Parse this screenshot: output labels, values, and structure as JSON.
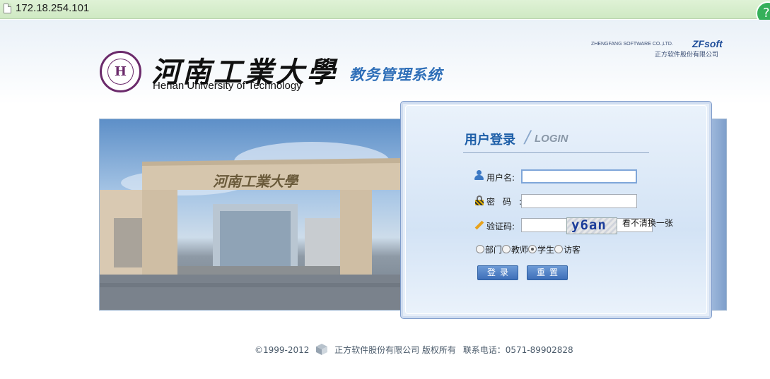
{
  "browser": {
    "url": "172.18.254.101"
  },
  "header": {
    "university_cn": "河南工業大學",
    "university_en": "Henan University of Technology",
    "system_name": "教务管理系统",
    "vendor_en": "ZHENGFANG SOFTWARE CO.,LTD.",
    "vendor_brand": "ZFsoft",
    "vendor_cn": "正方软件股份有限公司"
  },
  "login": {
    "title_cn": "用户登录",
    "title_slash": "/",
    "title_en": "LOGIN",
    "username_label": "用户名:",
    "username_value": "",
    "password_label": "密码:",
    "password_value": "",
    "captcha_label": "验证码:",
    "captcha_value": "",
    "captcha_image_text": "y6an",
    "captcha_refresh": "看不清换一张",
    "roles": [
      {
        "label": "部门",
        "checked": false
      },
      {
        "label": "教师",
        "checked": false
      },
      {
        "label": "学生",
        "checked": true
      },
      {
        "label": "访客",
        "checked": false
      }
    ],
    "login_button": "登录",
    "reset_button": "重置"
  },
  "campus_photo": {
    "gate_text": "河南工業大學"
  },
  "footer": {
    "copyright": "©1999-2012",
    "company": "正方软件股份有限公司 版权所有",
    "phone": "联系电话：0571-89902828"
  }
}
